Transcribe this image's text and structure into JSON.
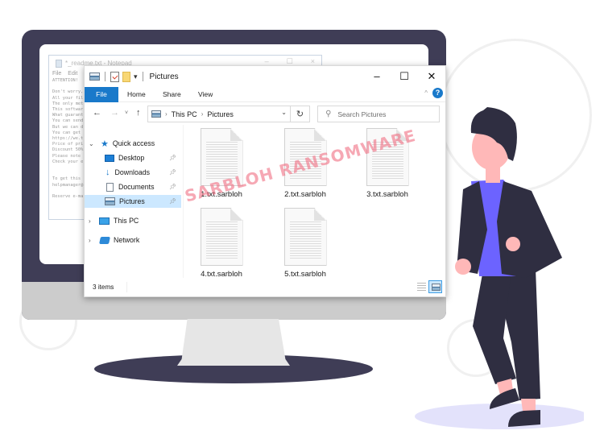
{
  "notepad": {
    "title": "*_readme.txt - Notepad",
    "menu": [
      "File",
      "Edit"
    ],
    "controls": [
      "–",
      "☐",
      "×"
    ],
    "body_lines": [
      "ATTENTION!",
      "",
      "Don't worry,",
      "All your fil",
      "The only met",
      "This softwar",
      "What guarant",
      "You can send",
      "But we can d",
      "You can get",
      "https://we.t",
      "Price of pri",
      "Discount 50%",
      "Please note",
      "Check your e",
      "",
      "",
      "To get this",
      "helpmanager@",
      "",
      "Reserve e-ma"
    ]
  },
  "explorer": {
    "title": "Pictures",
    "window_controls": {
      "minimize": "–",
      "maximize": "☐",
      "close": "✕"
    },
    "ribbon_tabs": [
      "File",
      "Home",
      "Share",
      "View"
    ],
    "help": "?",
    "nav": {
      "back": "←",
      "forward": "→",
      "recent": "˅",
      "up": "↑"
    },
    "address": {
      "segments": [
        "This PC",
        "Pictures"
      ],
      "separator": "›",
      "dropdown": "⌄"
    },
    "refresh": "↻",
    "search_placeholder": "Search Pictures",
    "sidebar": [
      {
        "label": "Quick access",
        "icon": "star-icon",
        "expand": "⌄"
      },
      {
        "label": "Desktop",
        "icon": "desktop-icon",
        "pinned": true
      },
      {
        "label": "Downloads",
        "icon": "download-icon",
        "pinned": true
      },
      {
        "label": "Documents",
        "icon": "documents-icon",
        "pinned": true
      },
      {
        "label": "Pictures",
        "icon": "pictures-icon",
        "pinned": true,
        "selected": true
      },
      {
        "label": "This PC",
        "icon": "computer-icon",
        "expand": "›"
      },
      {
        "label": "Network",
        "icon": "network-icon",
        "expand": "›"
      }
    ],
    "files": [
      "1.txt.sarbloh",
      "2.txt.sarbloh",
      "3.txt.sarbloh",
      "4.txt.sarbloh",
      "5.txt.sarbloh"
    ],
    "status": "3 items"
  },
  "watermark": "SARBLOH RANSOMWARE",
  "colors": {
    "accent": "#1979ca",
    "monitor": "#3f3d56",
    "shirt": "#6c63ff",
    "skin": "#ffb8b8",
    "watermark": "#f06e82"
  }
}
